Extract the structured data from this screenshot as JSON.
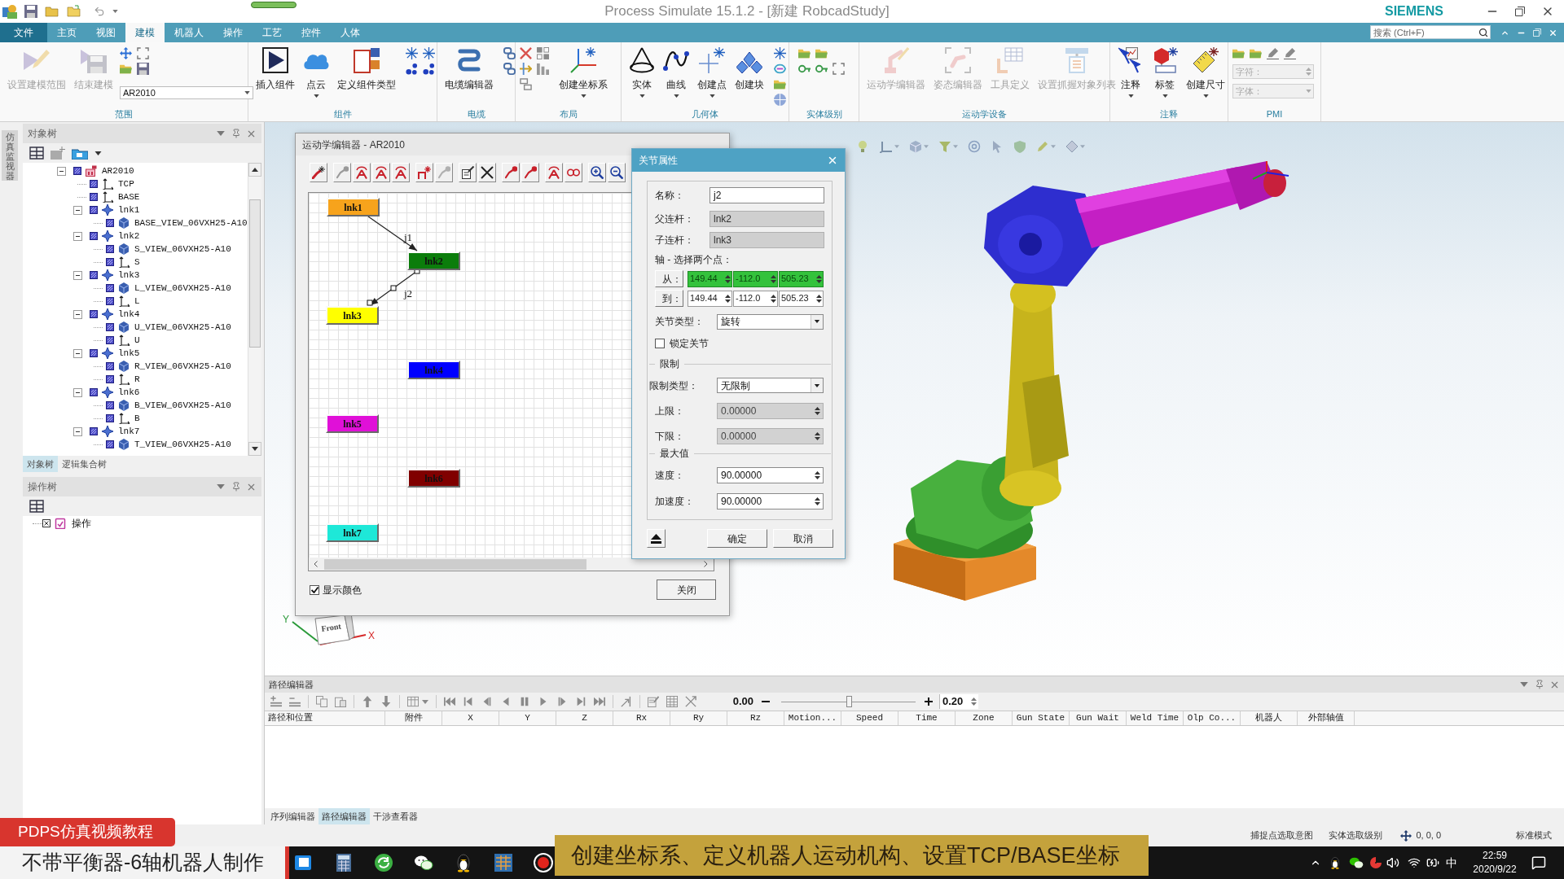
{
  "title_bar": {
    "title": "Process Simulate 15.1.2 - [新建 RobcadStudy]",
    "brand": "SIEMENS"
  },
  "menu_tabs": [
    {
      "label": "文件",
      "kind": "file",
      "selected": false
    },
    {
      "label": "主页",
      "kind": "tab",
      "selected": false
    },
    {
      "label": "视图",
      "kind": "tab",
      "selected": false
    },
    {
      "label": "建模",
      "kind": "tab",
      "selected": true
    },
    {
      "label": "机器人",
      "kind": "tab",
      "selected": false
    },
    {
      "label": "操作",
      "kind": "tab",
      "selected": false
    },
    {
      "label": "工艺",
      "kind": "tab",
      "selected": false
    },
    {
      "label": "控件",
      "kind": "tab",
      "selected": false
    },
    {
      "label": "人体",
      "kind": "tab",
      "selected": false
    }
  ],
  "search": {
    "placeholder": "搜索 (Ctrl+F)"
  },
  "ribbon": [
    {
      "label": "范围",
      "buttons": [
        {
          "label": "设置建模范围",
          "disabled": true,
          "menu": false
        },
        {
          "label": "结束建模",
          "disabled": true,
          "menu": false
        }
      ],
      "dropdown": {
        "value": "AR2010"
      }
    },
    {
      "label": "组件",
      "buttons": [
        {
          "label": "插入组件",
          "disabled": false,
          "menu": false
        },
        {
          "label": "点云",
          "disabled": false,
          "menu": true
        },
        {
          "label": "定义组件类型",
          "disabled": false,
          "menu": false
        }
      ]
    },
    {
      "label": "电缆",
      "buttons": [
        {
          "label": "电缆编辑器",
          "disabled": false,
          "menu": false
        }
      ]
    },
    {
      "label": "布局",
      "buttons": [
        {
          "label": "创建坐标系",
          "disabled": false,
          "menu": true
        }
      ]
    },
    {
      "label": "几何体",
      "buttons": [
        {
          "label": "实体",
          "disabled": false,
          "menu": true
        },
        {
          "label": "曲线",
          "disabled": false,
          "menu": true
        },
        {
          "label": "创建点",
          "disabled": false,
          "menu": true
        },
        {
          "label": "创建块",
          "disabled": false,
          "menu": false
        }
      ]
    },
    {
      "label": "实体级别"
    },
    {
      "label": "运动学设备",
      "buttons": [
        {
          "label": "运动学编辑器",
          "disabled": true,
          "menu": false
        },
        {
          "label": "姿态编辑器",
          "disabled": true,
          "menu": false
        },
        {
          "label": "工具定义",
          "disabled": true,
          "menu": false
        },
        {
          "label": "设置抓握对象列表",
          "disabled": true,
          "menu": false
        }
      ]
    },
    {
      "label": "注释",
      "buttons": [
        {
          "label": "注释",
          "disabled": false,
          "menu": true
        },
        {
          "label": "标签",
          "disabled": false,
          "menu": true
        },
        {
          "label": "创建尺寸",
          "disabled": false,
          "menu": true
        }
      ]
    },
    {
      "label": "PMI",
      "fields": [
        {
          "kind": "spin",
          "placeholder": "字符：",
          "disabled": true
        },
        {
          "kind": "combo",
          "placeholder": "字体：",
          "disabled": true
        }
      ]
    }
  ],
  "side_tab": {
    "label": "仿真监视器"
  },
  "object_tree": {
    "title": "对象树",
    "items": [
      {
        "label": "AR2010",
        "kind": "component",
        "expanded": true,
        "children": [
          {
            "label": "TCP",
            "kind": "frame"
          },
          {
            "label": "BASE",
            "kind": "frame"
          },
          {
            "label": "lnk1",
            "kind": "link",
            "expanded": true,
            "children": [
              {
                "label": "BASE_VIEW_06VXH25-A10",
                "kind": "part"
              }
            ]
          },
          {
            "label": "lnk2",
            "kind": "link",
            "expanded": true,
            "children": [
              {
                "label": "S_VIEW_06VXH25-A10",
                "kind": "part"
              },
              {
                "label": "S",
                "kind": "frame"
              }
            ]
          },
          {
            "label": "lnk3",
            "kind": "link",
            "expanded": true,
            "children": [
              {
                "label": "L_VIEW_06VXH25-A10",
                "kind": "part"
              },
              {
                "label": "L",
                "kind": "frame"
              }
            ]
          },
          {
            "label": "lnk4",
            "kind": "link",
            "expanded": true,
            "children": [
              {
                "label": "U_VIEW_06VXH25-A10",
                "kind": "part"
              },
              {
                "label": "U",
                "kind": "frame"
              }
            ]
          },
          {
            "label": "lnk5",
            "kind": "link",
            "expanded": true,
            "children": [
              {
                "label": "R_VIEW_06VXH25-A10",
                "kind": "part"
              },
              {
                "label": "R",
                "kind": "frame"
              }
            ]
          },
          {
            "label": "lnk6",
            "kind": "link",
            "expanded": true,
            "children": [
              {
                "label": "B_VIEW_06VXH25-A10",
                "kind": "part"
              },
              {
                "label": "B",
                "kind": "frame"
              }
            ]
          },
          {
            "label": "lnk7",
            "kind": "link",
            "expanded": true,
            "children": [
              {
                "label": "T_VIEW_06VXH25-A10",
                "kind": "part"
              }
            ]
          }
        ]
      }
    ],
    "tabs": [
      {
        "label": "对象树",
        "selected": true
      },
      {
        "label": "逻辑集合树",
        "selected": false
      }
    ]
  },
  "operation_tree": {
    "title": "操作树",
    "items": [
      {
        "label": "操作",
        "kind": "operation"
      }
    ]
  },
  "kinematics_editor": {
    "title": "运动学编辑器 - AR2010",
    "links": [
      {
        "label": "lnk1",
        "color": "#f7a31c"
      },
      {
        "label": "lnk2",
        "color": "#0b7d0b"
      },
      {
        "label": "lnk3",
        "color": "#ffff00"
      },
      {
        "label": "lnk4",
        "color": "#0000ff"
      },
      {
        "label": "lnk5",
        "color": "#e010d8"
      },
      {
        "label": "lnk6",
        "color": "#800000"
      },
      {
        "label": "lnk7",
        "color": "#1ee8d8"
      }
    ],
    "joints": [
      {
        "label": "j1",
        "selected": false
      },
      {
        "label": "j2",
        "selected": true
      }
    ],
    "show_colors": {
      "label": "显示颜色",
      "checked": true
    },
    "close_button": "关闭"
  },
  "joint_dialog": {
    "title": "关节属性",
    "name": {
      "label": "名称：",
      "value": "j2",
      "disabled": false
    },
    "parent_link": {
      "label": "父连杆：",
      "value": "lnk2",
      "disabled": true
    },
    "child_link": {
      "label": "子连杆：",
      "value": "lnk3",
      "disabled": true
    },
    "axis": {
      "label": "轴 - 选择两个点：",
      "from": {
        "label": "从：",
        "values": [
          "149.44",
          "-112.0",
          "505.23"
        ],
        "selected": true
      },
      "to": {
        "label": "到：",
        "values": [
          "149.44",
          "-112.0",
          "505.23"
        ],
        "selected": false
      }
    },
    "joint_type": {
      "label": "关节类型：",
      "value": "旋转"
    },
    "lock_joint": {
      "label": "锁定关节",
      "checked": false
    },
    "limits": {
      "title": "限制",
      "type": {
        "label": "限制类型：",
        "value": "无限制"
      },
      "upper": {
        "label": "上限：",
        "value": "0.00000",
        "disabled": true
      },
      "lower": {
        "label": "下限：",
        "value": "0.00000",
        "disabled": true
      }
    },
    "max_values": {
      "title": "最大值",
      "speed": {
        "label": "速度：",
        "value": "90.00000",
        "disabled": false
      },
      "acceleration": {
        "label": "加速度：",
        "value": "90.00000",
        "disabled": false
      }
    },
    "buttons": [
      {
        "label": "确定"
      },
      {
        "label": "取消"
      }
    ]
  },
  "viewport": {
    "view_cube_face": "Front",
    "axis_labels": [
      "Y",
      "X"
    ]
  },
  "path_editor": {
    "title": "路径编辑器",
    "time": "0.00",
    "step": "0.20",
    "slider": {
      "level": 0.5
    },
    "columns": [
      "路径和位置",
      "附件",
      "X",
      "Y",
      "Z",
      "Rx",
      "Ry",
      "Rz",
      "Motion...",
      "Speed",
      "Time",
      "Zone",
      "Gun State",
      "Gun Wait",
      "Weld Time",
      "Olp Co...",
      "机器人",
      "外部轴值"
    ],
    "tabs": [
      {
        "label": "序列编辑器",
        "selected": false
      },
      {
        "label": "路径编辑器",
        "selected": true
      },
      {
        "label": "干涉查看器",
        "selected": false
      }
    ]
  },
  "status_bar": {
    "items": [
      "捕捉点选取意图",
      "实体选取级别"
    ],
    "coordinates": "0, 0, 0",
    "mode": "标准模式"
  },
  "taskbar": {
    "ime": "中",
    "time": "22:59",
    "date": "2020/9/22"
  },
  "video_captions": {
    "channel": "PDPS仿真视频教程",
    "episode": "不带平衡器-6轴机器人制作",
    "subtitle": "创建坐标系、定义机器人运动机构、设置TCP/BASE坐标"
  }
}
